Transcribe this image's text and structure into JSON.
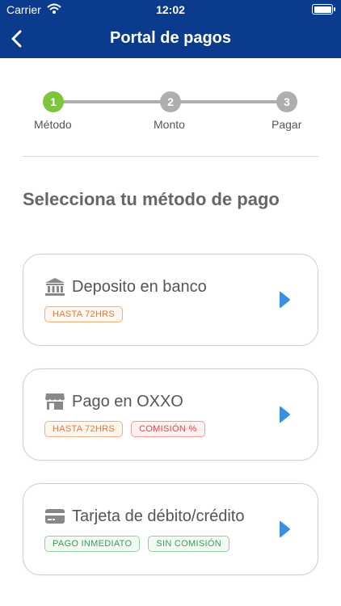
{
  "status_bar": {
    "carrier": "Carrier",
    "time": "12:02"
  },
  "nav": {
    "title": "Portal de pagos",
    "back_icon": "chevron-left-icon"
  },
  "stepper": {
    "steps": [
      {
        "number": "1",
        "label": "Método",
        "state": "active"
      },
      {
        "number": "2",
        "label": "Monto",
        "state": "inactive"
      },
      {
        "number": "3",
        "label": "Pagar",
        "state": "inactive"
      }
    ]
  },
  "heading": "Selecciona tu método de pago",
  "methods": [
    {
      "title": "Deposito en banco",
      "icon": "bank-icon",
      "badges": [
        {
          "text": "HASTA 72HRS",
          "color": "orange"
        }
      ]
    },
    {
      "title": "Pago en OXXO",
      "icon": "store-icon",
      "badges": [
        {
          "text": "HASTA 72HRS",
          "color": "orange"
        },
        {
          "text": "COMISIÓN %",
          "color": "red"
        }
      ]
    },
    {
      "title": "Tarjeta de débito/crédito",
      "icon": "credit-card-icon",
      "badges": [
        {
          "text": "PAGO INMEDIATO",
          "color": "green"
        },
        {
          "text": "SIN COMISIÓN",
          "color": "green"
        }
      ]
    }
  ],
  "colors": {
    "header": "#0b3b8c",
    "step_active": "#7dc63b",
    "step_inactive": "#aeaeae",
    "chevron": "#3b8fe0"
  }
}
